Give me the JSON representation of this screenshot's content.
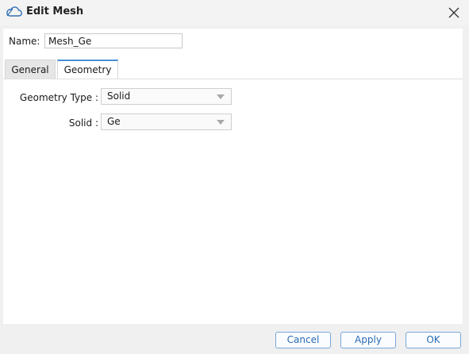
{
  "window": {
    "title": "Edit Mesh",
    "title_icon": "mesh-cloud-icon",
    "close_icon": "close-icon"
  },
  "name_field": {
    "label": "Name:",
    "value": "Mesh_Ge"
  },
  "tabs": [
    {
      "label": "General",
      "active": false
    },
    {
      "label": "Geometry",
      "active": true
    }
  ],
  "geometry": {
    "type_label": "Geometry Type :",
    "type_value": "Solid",
    "solid_label": "Solid :",
    "solid_value": "Ge"
  },
  "footer": {
    "cancel": "Cancel",
    "apply": "Apply",
    "ok": "OK"
  },
  "colors": {
    "accent": "#4a90d9",
    "button_text": "#2a6bb3"
  }
}
